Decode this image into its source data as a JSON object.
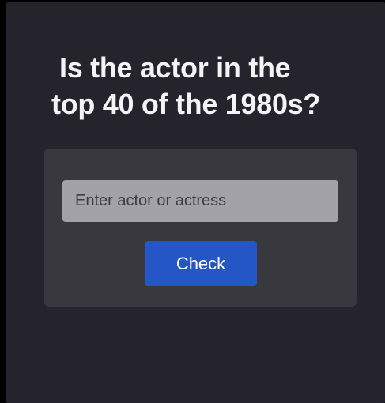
{
  "header": {
    "title_line1": "Is the actor in the",
    "title_line2": "top 40 of the 1980s?"
  },
  "form": {
    "input_placeholder": "Enter actor or actress",
    "input_value": "",
    "button_label": "Check"
  },
  "colors": {
    "background": "#25232c",
    "card": "#3a383f",
    "input": "#a3a2a8",
    "button": "#2556c6",
    "title_text": "#f4f4f6"
  }
}
